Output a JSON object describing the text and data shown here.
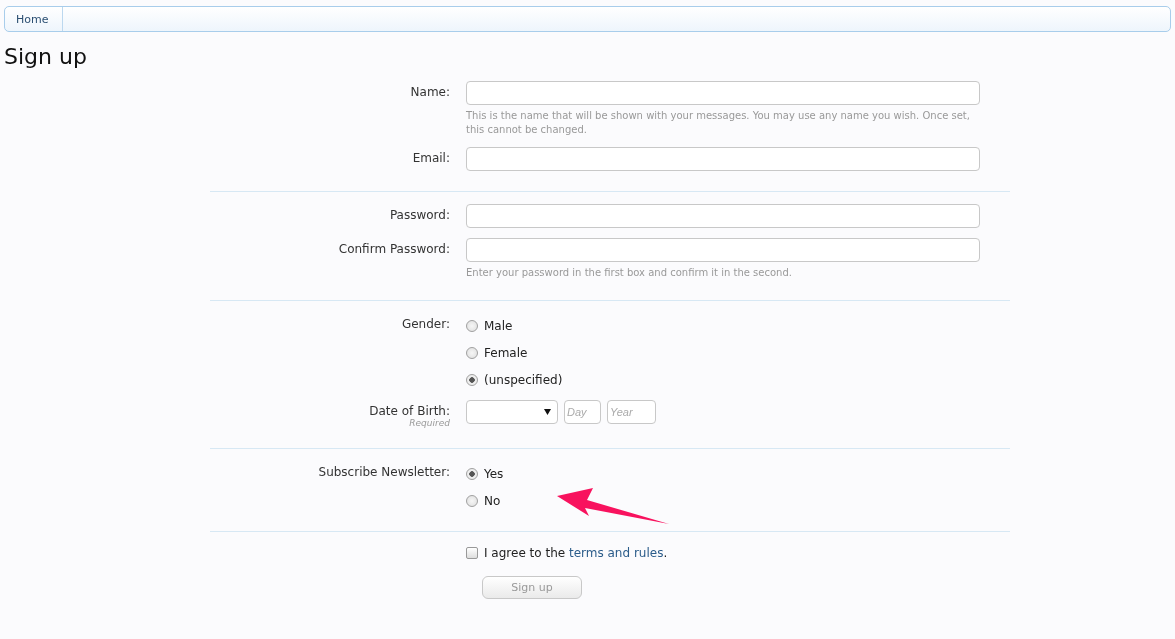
{
  "breadcrumb": [
    {
      "label": "Home"
    }
  ],
  "title": "Sign up",
  "sections": [
    {
      "rows": [
        {
          "kind": "text",
          "label": "Name:",
          "hint": "This is the name that will be shown with your messages. You may use any name you wish. Once set, this cannot be changed."
        },
        {
          "kind": "text",
          "label": "Email:"
        }
      ]
    },
    {
      "rows": [
        {
          "kind": "text",
          "label": "Password:"
        },
        {
          "kind": "text",
          "label": "Confirm Password:",
          "hint": "Enter your password in the first box and confirm it in the second."
        }
      ]
    },
    {
      "rows": [
        {
          "kind": "radio",
          "label": "Gender:",
          "options": [
            {
              "label": "Male",
              "selected": false
            },
            {
              "label": "Female",
              "selected": false
            },
            {
              "label": "(unspecified)",
              "selected": true
            }
          ]
        },
        {
          "kind": "date",
          "label": "Date of Birth:",
          "sublabel": "Required",
          "day_placeholder": "Day",
          "year_placeholder": "Year"
        }
      ]
    },
    {
      "rows": [
        {
          "kind": "radio",
          "label": "Subscribe Newsletter:",
          "options": [
            {
              "label": "Yes",
              "selected": true
            },
            {
              "label": "No",
              "selected": false
            }
          ]
        }
      ]
    }
  ],
  "agree": {
    "checked": false,
    "text": "I agree to the ",
    "link": "terms and rules",
    "after": "."
  },
  "submit": {
    "label": "Sign up",
    "disabled": true
  }
}
